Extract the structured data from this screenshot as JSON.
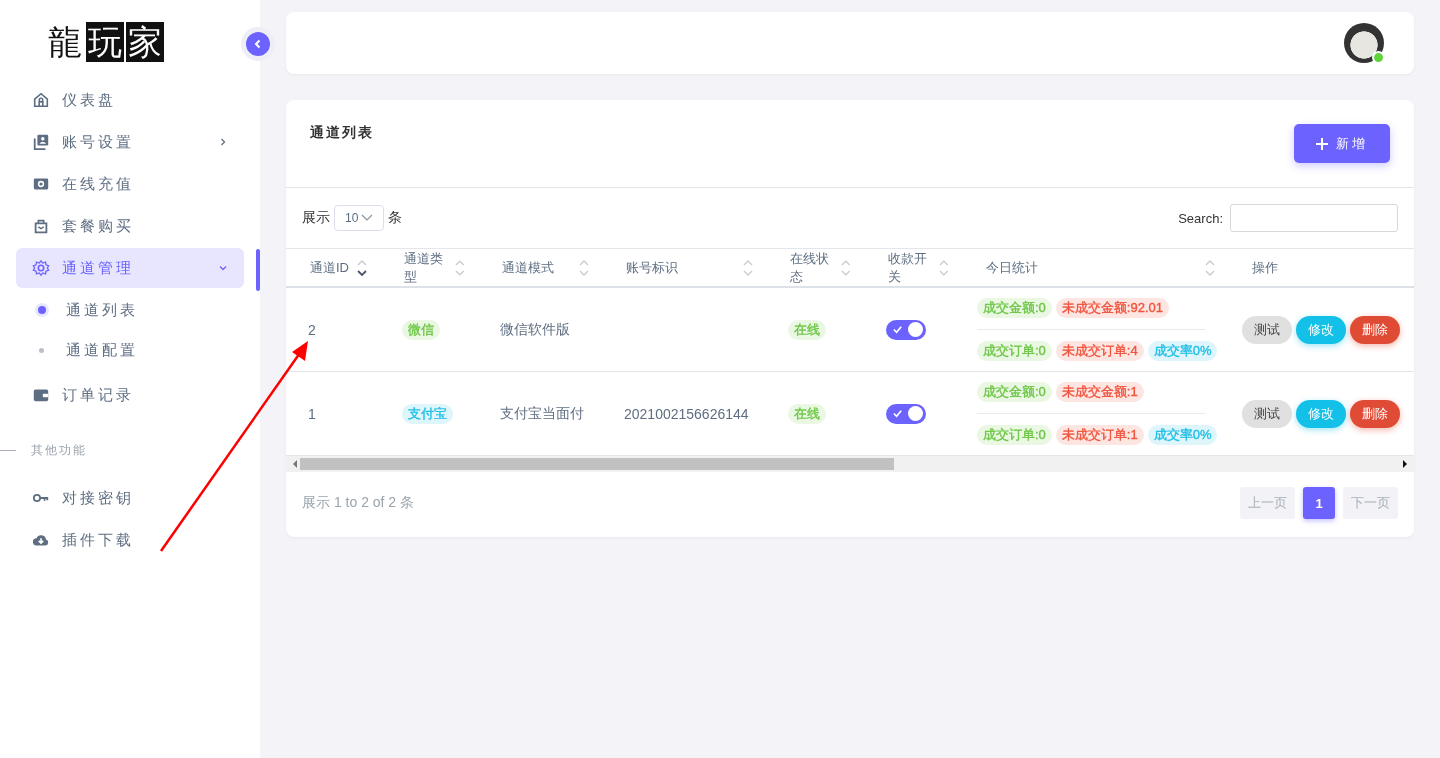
{
  "logo": [
    {
      "text": "龍",
      "inverted": false
    },
    {
      "text": "玩",
      "inverted": true
    },
    {
      "text": "家",
      "inverted": true
    }
  ],
  "sidebar": {
    "sections": [
      {
        "items": [
          {
            "label": "仪表盘",
            "selected": false
          },
          {
            "label": "账号设置",
            "selected": false,
            "expanded": false
          },
          {
            "label": "在线充值",
            "selected": false
          },
          {
            "label": "套餐购买",
            "selected": false
          },
          {
            "label": "通道管理",
            "selected": true,
            "expanded": true,
            "children": [
              {
                "label": "通道列表",
                "selected": true
              },
              {
                "label": "通道配置",
                "selected": false
              }
            ]
          },
          {
            "label": "订单记录",
            "selected": false
          }
        ]
      },
      {
        "heading": "其他功能",
        "items": [
          {
            "label": "对接密钥",
            "selected": false
          },
          {
            "label": "插件下载",
            "selected": false
          }
        ]
      }
    ]
  },
  "header": {
    "avatar": {
      "online": true
    }
  },
  "card": {
    "title": "通道列表",
    "add_button": "新增",
    "length_before": "展示",
    "length_value": "10",
    "length_after": "条",
    "search_label": "Search:",
    "table": {
      "columns": [
        {
          "label": "通道ID",
          "sorted_desc": true
        },
        {
          "label": "通道类型",
          "sorted_desc": false
        },
        {
          "label": "通道模式",
          "sorted_desc": false
        },
        {
          "label": "账号标识",
          "sorted_desc": false
        },
        {
          "label": "在线状态",
          "sorted_desc": false
        },
        {
          "label": "收款开关",
          "sorted_desc": false
        },
        {
          "label": "今日统计",
          "sorted_desc": false
        },
        {
          "label": "操作"
        }
      ],
      "rows": [
        {
          "id": "2",
          "type": {
            "text": "微信",
            "color": "#6cc644"
          },
          "mode": "微信软件版",
          "status": {
            "text": "在线",
            "color": "#6cc644"
          },
          "collect_on": true,
          "stats": [
            [
              {
                "text": "成交金额:0",
                "color": "#6cc644"
              },
              {
                "text": "未成交金额:92.01",
                "color": "#f0533c"
              }
            ],
            [
              {
                "text": "成交订单:0",
                "color": "#6cc644"
              },
              {
                "text": "未成交订单:4",
                "color": "#f0533c"
              },
              {
                "text": "成交率0%",
                "color": "#1cbde6"
              }
            ]
          ],
          "actions": [
            {
              "label": "测试",
              "kind": "test"
            },
            {
              "label": "修改",
              "kind": "edit"
            },
            {
              "label": "删除",
              "kind": "delete"
            }
          ]
        },
        {
          "id": "1",
          "type": {
            "text": "支付宝",
            "color": "#1cbde6"
          },
          "mode": "支付宝当面付",
          "account": "2021002156626144",
          "status": {
            "text": "在线",
            "color": "#6cc644"
          },
          "collect_on": true,
          "stats": [
            [
              {
                "text": "成交金额:0",
                "color": "#6cc644"
              },
              {
                "text": "未成交金额:1",
                "color": "#f0533c"
              }
            ],
            [
              {
                "text": "成交订单:0",
                "color": "#6cc644"
              },
              {
                "text": "未成交订单:1",
                "color": "#f0533c"
              },
              {
                "text": "成交率0%",
                "color": "#1cbde6"
              }
            ]
          ],
          "actions": [
            {
              "label": "测试",
              "kind": "test"
            },
            {
              "label": "修改",
              "kind": "edit"
            },
            {
              "label": "删除",
              "kind": "delete"
            }
          ]
        }
      ]
    },
    "info": "展示 1 to 2 of 2 条",
    "pagination": {
      "prev": {
        "label": "上一页",
        "disabled": true
      },
      "pages": [
        {
          "label": "1",
          "selected": true
        }
      ],
      "next": {
        "label": "下一页",
        "disabled": true
      }
    }
  }
}
